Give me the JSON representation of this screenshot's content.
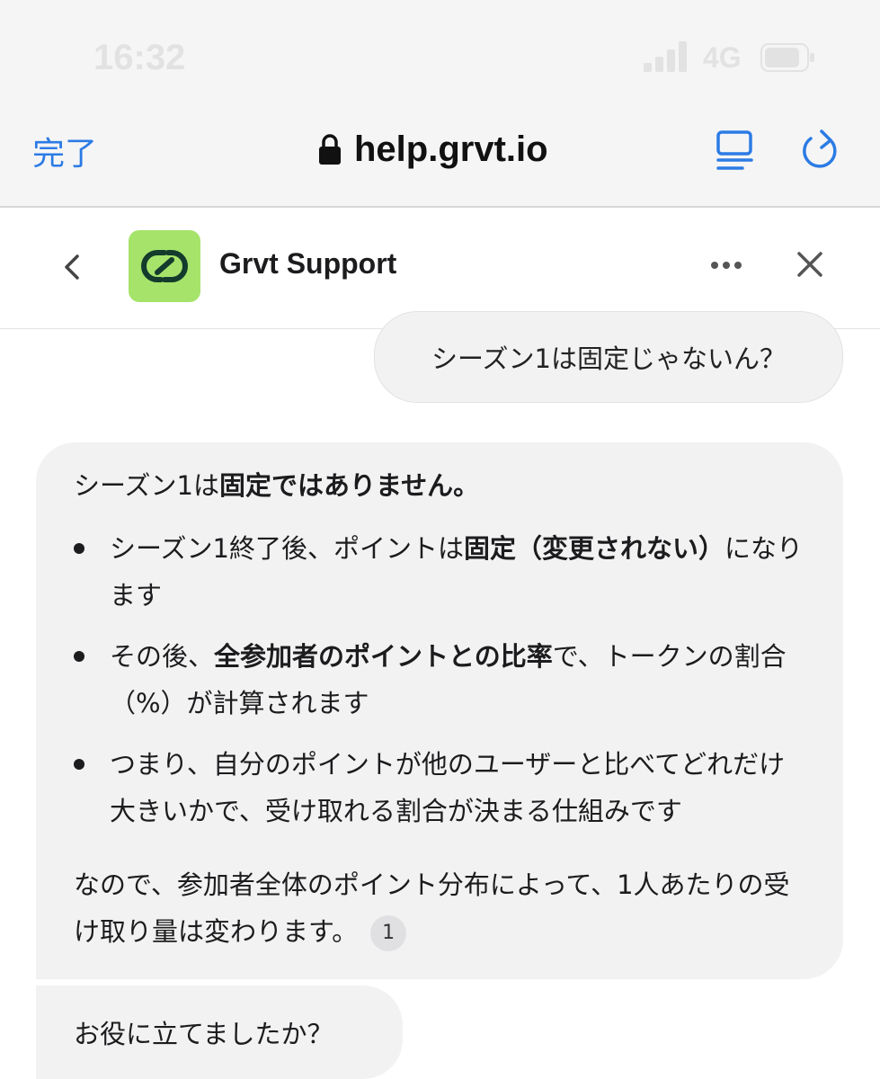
{
  "status_bar": {
    "time": "16:32",
    "network": "4G"
  },
  "browser": {
    "done_label": "完了",
    "url": "help.grvt.io"
  },
  "chat_header": {
    "title": "Grvt Support"
  },
  "messages": {
    "user": "シーズン1は固定じゃないん？",
    "bot": {
      "intro_plain": "シーズン1は",
      "intro_bold": "固定ではありません。",
      "bullets": [
        {
          "t1": "シーズン1終了後、ポイントは",
          "b1": "固定（変更されない）",
          "t2": "になります"
        },
        {
          "t1": "その後、",
          "b1": "全参加者のポイントとの比率",
          "t2": "で、トークンの割合（%）が計算されます"
        },
        {
          "t1": "つまり、自分のポイントが他のユーザーと比べてどれだけ大きいかで、受け取れる割合が決まる仕組みです",
          "b1": "",
          "t2": ""
        }
      ],
      "summary": "なので、参加者全体のポイント分布によって、1人あたりの受け取り量は変わります。",
      "citation": "1"
    },
    "bot_followup": "お役に立てましたか？"
  }
}
